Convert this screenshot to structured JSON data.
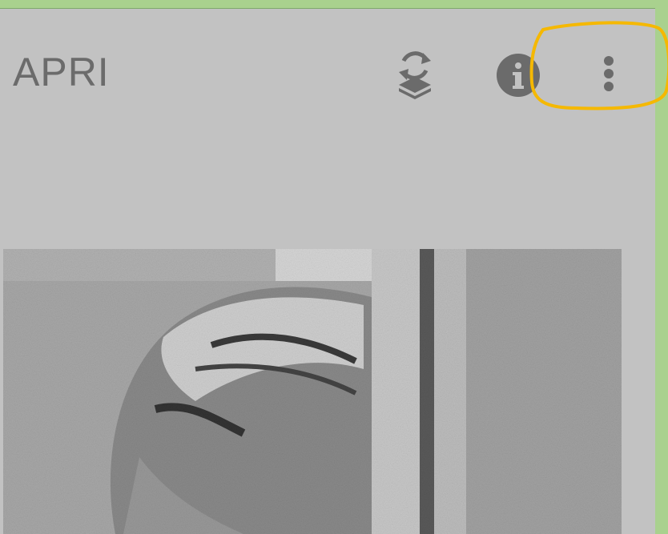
{
  "app": {
    "title": "APRI",
    "colors": {
      "page_background": "#a9d18e",
      "screen_background": "#c2c2c2",
      "icon_color": "#6b6b6b",
      "highlight": "#f5b800"
    }
  },
  "toolbar": {
    "icons": [
      "layers-rotate-icon",
      "info-icon",
      "more-vert-icon"
    ]
  },
  "image": {
    "description_icon": "photo",
    "style": "black-and-white"
  }
}
